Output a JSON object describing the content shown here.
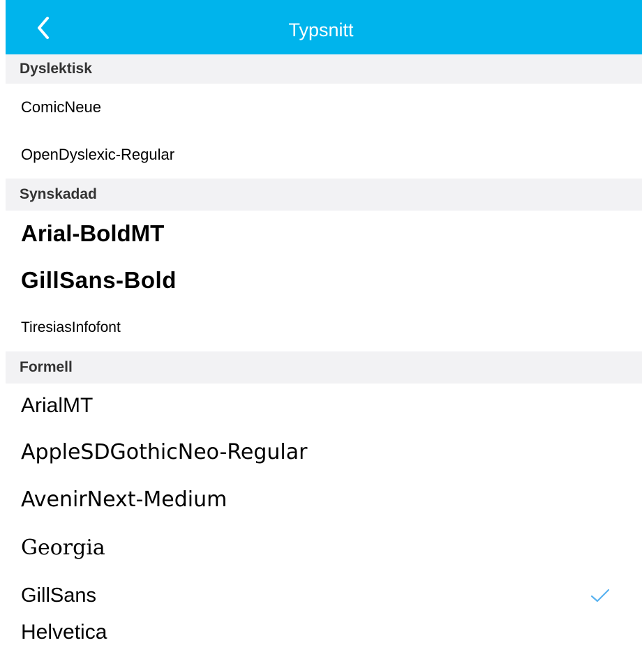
{
  "navbar": {
    "title": "Typsnitt",
    "accent": "#00b4ec"
  },
  "sections": {
    "dyslektisk": "Dyslektisk",
    "synskadad": "Synskadad",
    "formell": "Formell"
  },
  "fonts": {
    "comicneue": "ComicNeue",
    "opendyslexic": "OpenDyslexic-Regular",
    "arial_bold": "Arial-BoldMT",
    "gillsans_bold": "GillSans-Bold",
    "tiresias": "TiresiasInfofont",
    "arialmt": "ArialMT",
    "applesd": "AppleSDGothicNeo-Regular",
    "avenir": "AvenirNext-Medium",
    "georgia": "Georgia",
    "gillsans": "GillSans",
    "helvetica": "Helvetica"
  },
  "selected": "GillSans",
  "icons": {
    "back": "chevron-left-icon",
    "check": "checkmark-icon"
  }
}
